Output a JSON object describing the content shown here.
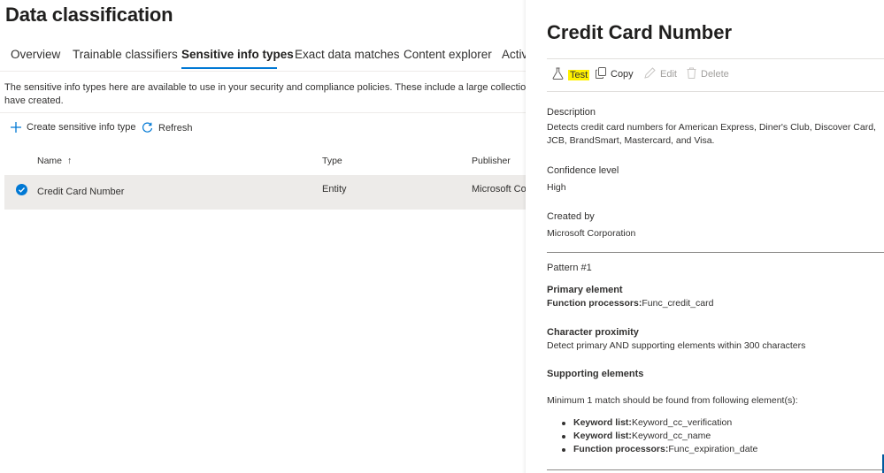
{
  "page": {
    "title": "Data classification",
    "tabs": [
      "Overview",
      "Trainable classifiers",
      "Sensitive info types",
      "Exact data matches",
      "Content explorer",
      "Activ"
    ],
    "active_tab": "Sensitive info types",
    "intro_line1": "The sensitive info types here are available to use in your security and compliance policies. These include a large collection of ty",
    "intro_line2": "have created.",
    "commands": {
      "create": "Create sensitive info type",
      "refresh": "Refresh"
    },
    "columns": {
      "name": "Name",
      "name_sort": "↑",
      "type": "Type",
      "publisher": "Publisher"
    },
    "rows": [
      {
        "name": "Credit Card Number",
        "type": "Entity",
        "publisher": "Microsoft Corp"
      }
    ]
  },
  "panel": {
    "title": "Credit Card Number",
    "actions": {
      "test": "Test",
      "copy": "Copy",
      "edit": "Edit",
      "delete": "Delete"
    },
    "description_label": "Description",
    "description_line1": "Detects credit card numbers for American Express, Diner's Club, Discover Card,",
    "description_line2": "JCB, BrandSmart, Mastercard, and Visa.",
    "confidence_label": "Confidence level",
    "confidence_value": "High",
    "created_by_label": "Created by",
    "created_by_value": "Microsoft Corporation",
    "pattern_label": "Pattern #1",
    "primary_label": "Primary element",
    "primary_key": "Function processors:",
    "primary_value": "Func_credit_card",
    "proximity_label": "Character proximity",
    "proximity_value": "Detect primary AND supporting elements within 300 characters",
    "supporting_label": "Supporting elements",
    "supporting_intro": "Minimum 1 match should be found from following element(s):",
    "supporting_items": [
      {
        "key": "Keyword list:",
        "value": "Keyword_cc_verification"
      },
      {
        "key": "Keyword list:",
        "value": "Keyword_cc_name"
      },
      {
        "key": "Function processors:",
        "value": "Func_expiration_date"
      }
    ]
  },
  "colors": {
    "accent": "#0078d4",
    "highlight": "#fff100",
    "row_selected": "#edebe9"
  },
  "icons": [
    "add-icon",
    "refresh-icon",
    "check-circle-icon",
    "beaker-icon",
    "copy-icon",
    "edit-icon",
    "delete-icon"
  ]
}
